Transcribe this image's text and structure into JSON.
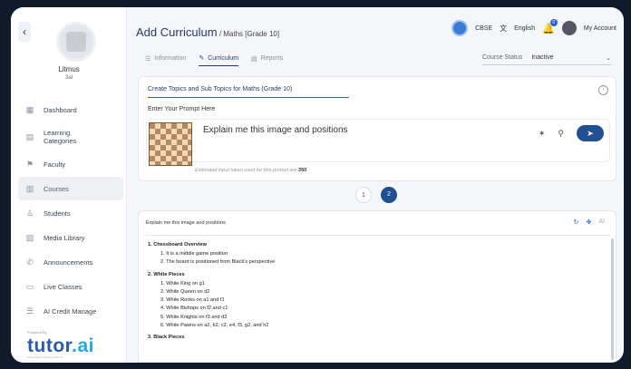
{
  "sidebar": {
    "back": "‹",
    "user_name": "Litmus",
    "user_sub": "3al",
    "items": [
      {
        "label": "Dashboard",
        "icon": "▦"
      },
      {
        "label": "Learning\nCategories",
        "icon": "▤"
      },
      {
        "label": "Faculty",
        "icon": "⚑"
      },
      {
        "label": "Courses",
        "icon": "▥"
      },
      {
        "label": "Students",
        "icon": "♙"
      },
      {
        "label": "Media Library",
        "icon": "▧"
      },
      {
        "label": "Announcements",
        "icon": "✆"
      },
      {
        "label": "Live Classes",
        "icon": "▭"
      },
      {
        "label": "AI Credit Manage",
        "icon": "☰"
      }
    ],
    "powered_by": "Powered By",
    "logo_brand": "tutor",
    "logo_suffix": ".ai",
    "logo_tagline": "Personalized learning with AI"
  },
  "header": {
    "title": "Add Curriculum",
    "subtitle": " / Maths [Grade 10]",
    "board": "CBSE",
    "language": "English",
    "notification_count": "0",
    "account": "My Account"
  },
  "tabs": [
    {
      "label": "Information",
      "active": false
    },
    {
      "label": "Curriculum",
      "active": true
    },
    {
      "label": "Reports",
      "active": false
    }
  ],
  "course_status": {
    "label": "Course Status",
    "value": "Inactive"
  },
  "prompt_card": {
    "title": "Create Topics and Sub Topics for Maths (Grade 10)",
    "prompt_label": "Enter Your Prompt Here",
    "prompt_text": "Explain me this image and positions",
    "token_note": "Estimated input token used for this prompt are ",
    "token_count": "350"
  },
  "pagination": [
    "1",
    "2"
  ],
  "response": {
    "heading": "Explain me this image and positions",
    "ai_label": "AI",
    "sections": [
      {
        "title": "1. Chessboard Overview",
        "items": [
          "1. It is a middle game position",
          "2. The board is positioned from Black's perspective"
        ]
      },
      {
        "title": "2. White Pieces",
        "items": [
          "1. White King on g1",
          "2. White Queen on d2",
          "3. White Rooks on a1 and f1",
          "4. White Bishops on f2 and c1",
          "5. White Knights on f3 and d2",
          "6. White Pawns on a2, b2, c2, e4, f3, g2, and h2"
        ]
      },
      {
        "title": "3. Black Pieces",
        "items": []
      }
    ]
  }
}
